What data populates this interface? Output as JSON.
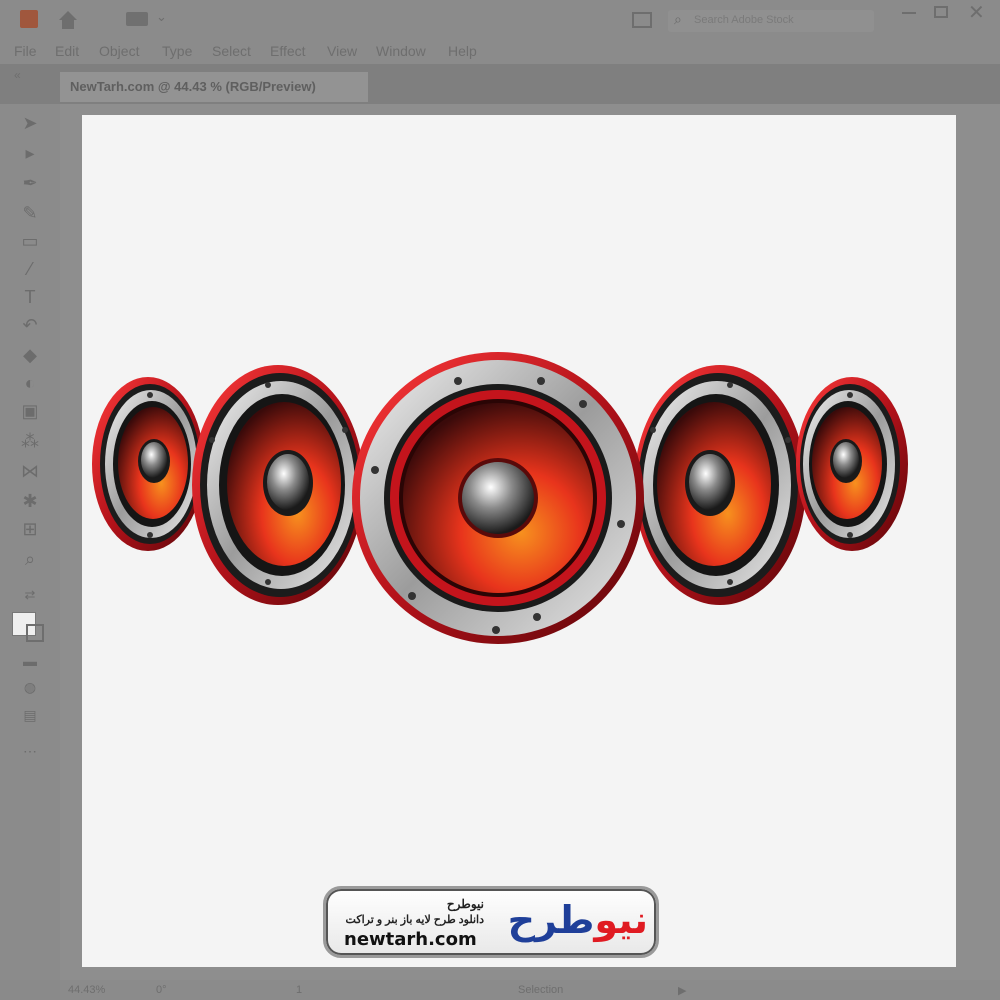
{
  "app": {
    "menu": [
      "File",
      "Edit",
      "Object",
      "Type",
      "Select",
      "Effect",
      "View",
      "Window",
      "Help"
    ],
    "search_placeholder": "Search Adobe Stock",
    "document_tab": "NewTarh.com @ 44.43 % (RGB/Preview)"
  },
  "status": {
    "zoom": "44.43%",
    "rotation": "0°",
    "artboard": "1",
    "tool": "Selection"
  },
  "colors": {
    "speaker_red": "#d8141c",
    "speaker_orange": "#f47a1e",
    "chrome": "#c9c9c9",
    "logo_red": "#e01b22",
    "logo_blue": "#1f3f99"
  },
  "watermark": {
    "title_fa": "نیوطرح",
    "subtitle_fa": "دانلود طرح لایه باز بنر و تراکت",
    "url": "newtarh.com",
    "logo_red": "نیو",
    "logo_blue": "طرح"
  },
  "artwork": {
    "speaker_count": 5,
    "icons": [
      "speaker-small-left",
      "speaker-medium-left",
      "speaker-large-center",
      "speaker-medium-right",
      "speaker-small-right"
    ]
  }
}
